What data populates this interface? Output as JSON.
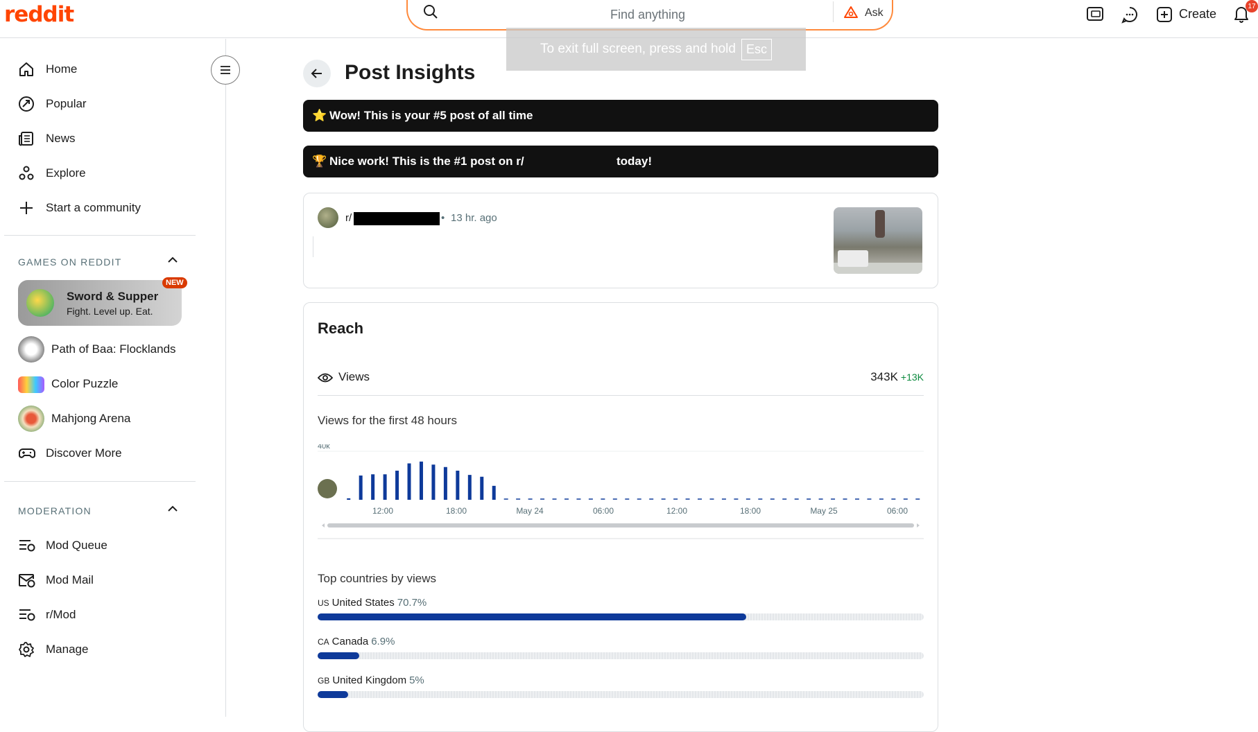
{
  "header": {
    "logo": "reddit",
    "search_placeholder": "Find anything",
    "ask_label": "Ask",
    "create_label": "Create",
    "notification_count": "17"
  },
  "fullscreen_toast": {
    "text": "To exit full screen, press and hold",
    "key": "Esc"
  },
  "sidebar": {
    "nav": [
      {
        "label": "Home",
        "icon": "home-icon"
      },
      {
        "label": "Popular",
        "icon": "popular-icon"
      },
      {
        "label": "News",
        "icon": "news-icon"
      },
      {
        "label": "Explore",
        "icon": "explore-icon"
      },
      {
        "label": "Start a community",
        "icon": "plus-icon"
      }
    ],
    "games_heading": "GAMES ON REDDIT",
    "featured_game": {
      "title": "Sword & Supper",
      "subtitle": "Fight. Level up. Eat.",
      "badge": "NEW"
    },
    "games": [
      {
        "label": "Path of Baa: Flocklands"
      },
      {
        "label": "Color Puzzle"
      },
      {
        "label": "Mahjong Arena"
      },
      {
        "label": "Discover More"
      }
    ],
    "moderation_heading": "MODERATION",
    "moderation": [
      {
        "label": "Mod Queue",
        "icon": "mod-queue-icon"
      },
      {
        "label": "Mod Mail",
        "icon": "mod-mail-icon"
      },
      {
        "label": "r/Mod",
        "icon": "r-mod-icon"
      },
      {
        "label": "Manage",
        "icon": "gear-icon"
      }
    ]
  },
  "main": {
    "title": "Post Insights",
    "banners": [
      {
        "emoji": "⭐",
        "text": "Wow! This is your #5 post of all time"
      },
      {
        "emoji": "🏆",
        "text_before": "Nice work! This is the #1 post on r/",
        "text_after": "today!"
      }
    ],
    "post": {
      "subreddit_prefix": "r/",
      "time": "13 hr. ago"
    },
    "reach": {
      "title": "Reach",
      "views_label": "Views",
      "views_value": "343K",
      "views_delta": "+13K",
      "chart_title": "Views for the first 48 hours",
      "countries_title": "Top countries by views",
      "countries": [
        {
          "code": "US",
          "name": "United States",
          "pct": "70.7%",
          "value": 70.7
        },
        {
          "code": "CA",
          "name": "Canada",
          "pct": "6.9%",
          "value": 6.9
        },
        {
          "code": "GB",
          "name": "United Kingdom",
          "pct": "5%",
          "value": 5
        }
      ]
    }
  },
  "chart_data": {
    "type": "bar",
    "ylim": [
      0,
      40000
    ],
    "y_tick_labels": [
      "40k"
    ],
    "x_tick_labels": [
      "12:00",
      "18:00",
      "May 24",
      "06:00",
      "12:00",
      "18:00",
      "May 25",
      "06:00"
    ],
    "values": [
      1200,
      20000,
      21000,
      21000,
      24000,
      30000,
      31500,
      29000,
      27000,
      24000,
      20500,
      19000,
      11500,
      0,
      0,
      0,
      0,
      0,
      0,
      0,
      0,
      0,
      0,
      0,
      0,
      0,
      0,
      0,
      0,
      0,
      0,
      0,
      0,
      0,
      0,
      0,
      0,
      0,
      0,
      0,
      0,
      0,
      0,
      0,
      0,
      0,
      0,
      0
    ],
    "bar_color": "#0e3a9a",
    "grid": true
  }
}
